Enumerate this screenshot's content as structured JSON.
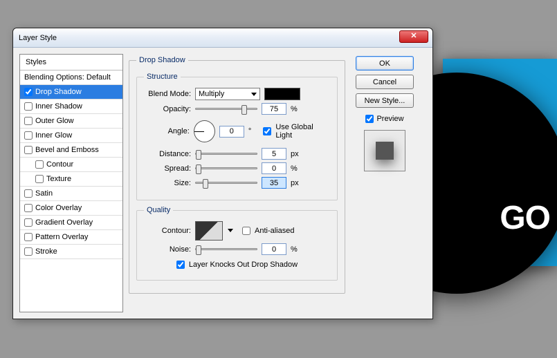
{
  "canvas": {
    "go_text": "GO"
  },
  "dialog": {
    "title": "Layer Style",
    "close_glyph": "✕",
    "styles_header": "Styles",
    "blending_row": "Blending Options: Default",
    "items": [
      {
        "label": "Drop Shadow",
        "checked": true,
        "selected": true
      },
      {
        "label": "Inner Shadow",
        "checked": false
      },
      {
        "label": "Outer Glow",
        "checked": false
      },
      {
        "label": "Inner Glow",
        "checked": false
      },
      {
        "label": "Bevel and Emboss",
        "checked": false
      },
      {
        "label": "Contour",
        "checked": false,
        "indent": true
      },
      {
        "label": "Texture",
        "checked": false,
        "indent": true
      },
      {
        "label": "Satin",
        "checked": false
      },
      {
        "label": "Color Overlay",
        "checked": false
      },
      {
        "label": "Gradient Overlay",
        "checked": false
      },
      {
        "label": "Pattern Overlay",
        "checked": false
      },
      {
        "label": "Stroke",
        "checked": false
      }
    ],
    "panel_title": "Drop Shadow",
    "structure": {
      "legend": "Structure",
      "blend_mode_label": "Blend Mode:",
      "blend_mode_value": "Multiply",
      "color": "#000000",
      "opacity_label": "Opacity:",
      "opacity_value": "75",
      "opacity_unit": "%",
      "angle_label": "Angle:",
      "angle_value": "0",
      "angle_unit": "°",
      "global_light_label": "Use Global Light",
      "global_light_checked": true,
      "distance_label": "Distance:",
      "distance_value": "5",
      "distance_unit": "px",
      "spread_label": "Spread:",
      "spread_value": "0",
      "spread_unit": "%",
      "size_label": "Size:",
      "size_value": "35",
      "size_unit": "px"
    },
    "quality": {
      "legend": "Quality",
      "contour_label": "Contour:",
      "antialiased_label": "Anti-aliased",
      "antialiased_checked": false,
      "noise_label": "Noise:",
      "noise_value": "0",
      "noise_unit": "%",
      "knockout_label": "Layer Knocks Out Drop Shadow",
      "knockout_checked": true
    },
    "buttons": {
      "ok": "OK",
      "cancel": "Cancel",
      "new_style": "New Style..."
    },
    "preview_label": "Preview",
    "preview_checked": true
  }
}
